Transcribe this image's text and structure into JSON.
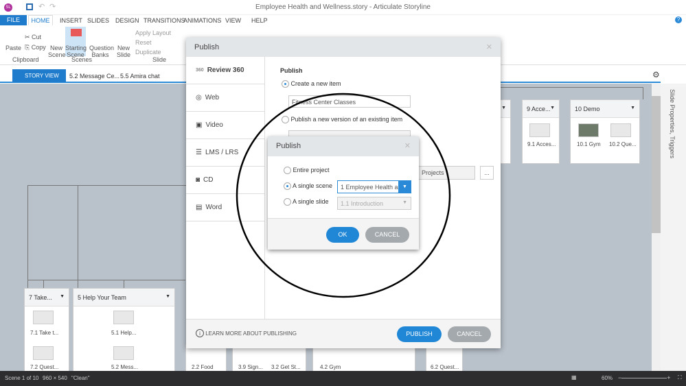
{
  "app": {
    "title": "Employee Health and Wellness.story - Articulate Storyline",
    "logo": "SL"
  },
  "ribbon_tabs": [
    "FILE",
    "HOME",
    "INSERT",
    "SLIDES",
    "DESIGN",
    "TRANSITIONS",
    "ANIMATIONS",
    "VIEW",
    "HELP"
  ],
  "ribbon": {
    "paste": "Paste",
    "cut": "Cut",
    "copy": "Copy",
    "clipboard": "Clipboard",
    "new_scene": "New Scene",
    "starting_scene": "Starting Scene",
    "question_banks": "Question Banks",
    "scenes": "Scenes",
    "new_slide": "New Slide",
    "apply_layout": "Apply Layout",
    "reset": "Reset",
    "duplicate": "Duplicate",
    "slide": "Slide"
  },
  "view_tabs": [
    "STORY VIEW",
    "5.2 Message Ce...",
    "5.5 Amira chat"
  ],
  "side_panel": "Slide Properties, Triggers",
  "scenes": {
    "s7": {
      "title": "7 Take...",
      "slides": [
        "7.1 Take t...",
        "7.2 Quest..."
      ]
    },
    "s5": {
      "title": "5 Help Your Team",
      "slides": [
        "5.1 Help...",
        "5.2 Mess..."
      ]
    },
    "s9": {
      "title": "9 Acce...",
      "slides": [
        "9.1 Acces..."
      ]
    },
    "s10": {
      "title": "10 Demo",
      "slides": [
        "10.1 Gym",
        "10.2 Que..."
      ]
    },
    "others": [
      "2.2 Food",
      "3.9 Sign...",
      "3.2 Get St...",
      "4.2 Gym",
      "6.2 Quest..."
    ]
  },
  "publish": {
    "title": "Publish",
    "nav": [
      "Review 360",
      "Web",
      "Video",
      "LMS / LRS",
      "CD",
      "Word"
    ],
    "section": "Publish",
    "create_new": "Create a new item",
    "item_name": "Fitness Center Classes",
    "new_version": "Publish a new version of an existing item",
    "folder": "Projects",
    "browse": "...",
    "learn_more": "LEARN MORE ABOUT PUBLISHING",
    "publish_btn": "PUBLISH",
    "cancel_btn": "CANCEL"
  },
  "sub": {
    "title": "Publish",
    "entire": "Entire project",
    "scene": "A single scene",
    "scene_value": "1 Employee Health a",
    "slide": "A single slide",
    "slide_value": "1.1 Introduction",
    "ok": "OK",
    "cancel": "CANCEL"
  },
  "status": {
    "scene": "Scene 1 of 10",
    "size": "960 × 540",
    "theme": "\"Clean\"",
    "zoom": "60%"
  }
}
